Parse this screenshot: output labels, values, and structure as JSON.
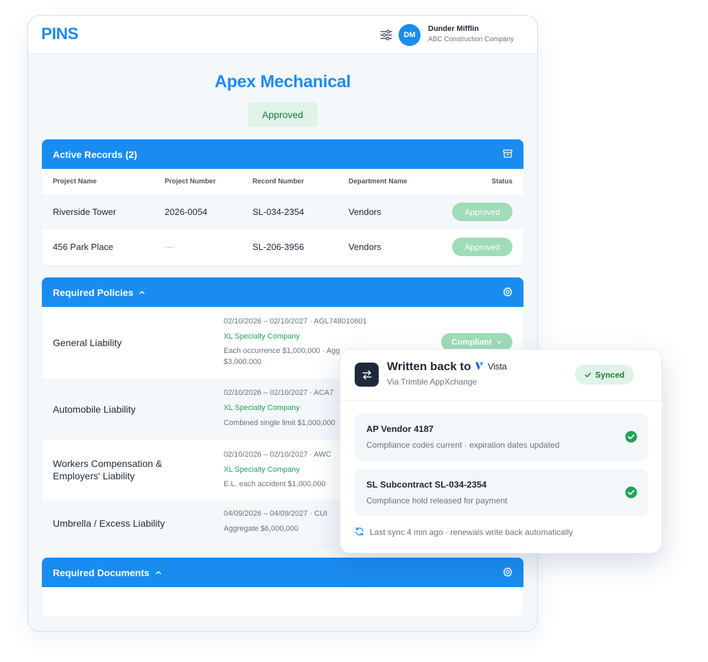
{
  "header": {
    "logo": "PINS",
    "user_initials": "DM",
    "user_name": "Dunder Mifflin",
    "user_company": "ABC Construction Company"
  },
  "page": {
    "title": "Apex Mechanical",
    "status": "Approved"
  },
  "active_records": {
    "title": "Active Records (2)",
    "columns": [
      "Project Name",
      "Project Number",
      "Record Number",
      "Department Name",
      "Status"
    ],
    "rows": [
      {
        "project": "Riverside Tower",
        "number": "2026-0054",
        "record": "SL-034-2354",
        "department": "Vendors",
        "status": "Approved"
      },
      {
        "project": "456 Park Place",
        "number": "···",
        "record": "SL-206-3956",
        "department": "Vendors",
        "status": "Approved"
      }
    ]
  },
  "required_policies": {
    "title": "Required Policies",
    "rows": [
      {
        "name": "General Liability",
        "dates": "02/10/2026 – 02/10/2027 · AGL748010801",
        "carrier": "XL Specialty Company",
        "detail": "Each occurrence $1,000,000 · Agg",
        "detail2": "$3,000,000",
        "status": "Compliant"
      },
      {
        "name": "Automobile Liability",
        "dates": "02/10/2026 – 02/10/2027 · ACA7",
        "carrier": "XL Specialty Company",
        "detail": "Combined single limit $1,000,000"
      },
      {
        "name": "Workers Compensation & Employers' Liability",
        "dates": "02/10/2026 – 02/10/2027 · AWC",
        "carrier": "XL Specialty Company",
        "detail": "E.L. each accident $1,000,000"
      },
      {
        "name": "Umbrella / Excess Liability",
        "dates": "04/09/2026 – 04/09/2027 · CUI",
        "detail": "Aggregate $6,000,000"
      }
    ]
  },
  "required_documents": {
    "title": "Required Documents"
  },
  "sync": {
    "title": "Written back to",
    "brand": "Vista",
    "subtitle": "Via Trimble AppXchange",
    "status": "Synced",
    "items": [
      {
        "title": "AP Vendor 4187",
        "desc": "Compliance codes current · expiration dates updated"
      },
      {
        "title": "SL Subcontract SL-034-2354",
        "desc": "Compliance hold released for payment"
      }
    ],
    "footer": "Last sync 4 min ago · renewals write back automatically"
  },
  "colors": {
    "brand_blue": "#1a8cf0",
    "approved_green": "#1e7a43",
    "pill_green": "#9fdcb7",
    "carrier_green": "#1fa259"
  },
  "icons": [
    "filter-icon",
    "archive-icon",
    "chevron-up-icon",
    "gear-icon",
    "swap-icon",
    "vista-logo-icon",
    "check-icon",
    "check-circle-icon",
    "refresh-icon",
    "chevron-down-icon"
  ]
}
